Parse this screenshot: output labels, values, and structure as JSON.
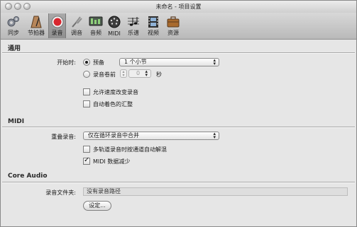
{
  "window": {
    "title": "未命名 - 项目设置"
  },
  "toolbar": {
    "items": [
      {
        "label": "同步",
        "icon": "gears-icon"
      },
      {
        "label": "节拍器",
        "icon": "metronome-icon"
      },
      {
        "label": "录音",
        "icon": "record-icon",
        "active": true
      },
      {
        "label": "调音",
        "icon": "tuning-fork-icon"
      },
      {
        "label": "音频",
        "icon": "audio-interface-icon"
      },
      {
        "label": "MIDI",
        "icon": "midi-connector-icon"
      },
      {
        "label": "乐谱",
        "icon": "score-icon"
      },
      {
        "label": "视频",
        "icon": "film-icon"
      },
      {
        "label": "资源",
        "icon": "briefcase-icon"
      }
    ]
  },
  "general": {
    "heading": "通用",
    "start_label": "开始时:",
    "count_in_label": "预备",
    "count_in_value": "1 个小节",
    "preroll_label": "录音卷前",
    "preroll_value": "0",
    "preroll_unit": "秒",
    "allow_tempo_label": "允许速度改变录音",
    "auto_color_label": "自动着色的汇整"
  },
  "midi": {
    "heading": "MIDI",
    "overlap_label": "重叠录音:",
    "overlap_value": "仅在循环录音中合并",
    "auto_demix_label": "多轨道录音时按通道自动解混",
    "midi_reduction_label": "MIDI 数据减少"
  },
  "core_audio": {
    "heading": "Core Audio",
    "folder_label": "录音文件夹:",
    "folder_value": "没有录音路径",
    "set_button": "设定..."
  },
  "colors": {
    "record_red": "#d8262e",
    "active_tab": "#9c9c9c"
  }
}
